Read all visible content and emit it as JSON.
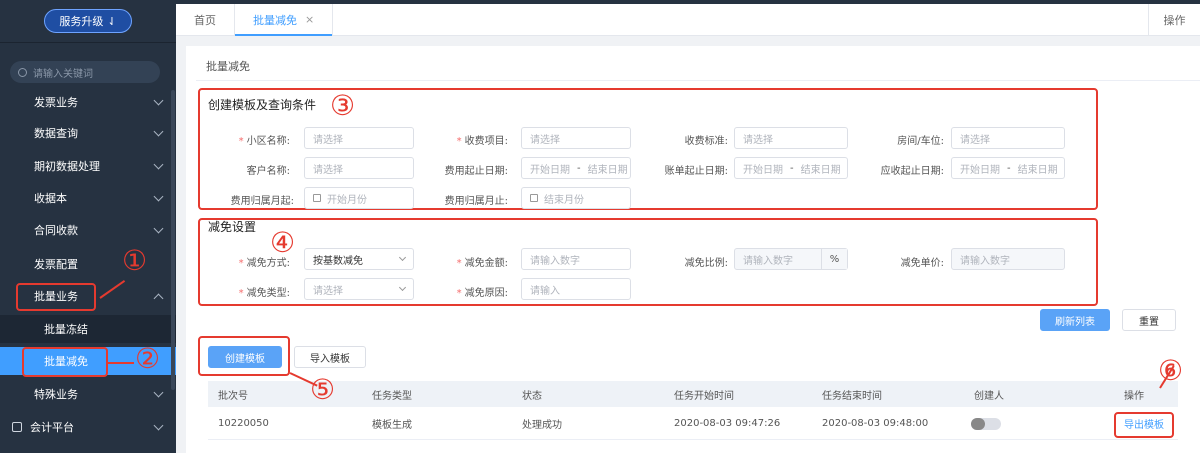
{
  "sidebar": {
    "upgrade_label": "服务升级",
    "search_placeholder": "请输入关键词",
    "items": [
      {
        "label": "发票业务"
      },
      {
        "label": "数据查询"
      },
      {
        "label": "期初数据处理"
      },
      {
        "label": "收据本"
      },
      {
        "label": "合同收款"
      },
      {
        "label": "发票配置"
      },
      {
        "label": "批量业务"
      },
      {
        "label": "批量冻结"
      },
      {
        "label": "批量减免"
      },
      {
        "label": "特殊业务"
      },
      {
        "label": "会计平台"
      }
    ]
  },
  "tabs": [
    {
      "label": "首页"
    },
    {
      "label": "批量减免",
      "close": "×"
    }
  ],
  "tab_actions_label": "操作",
  "page_title": "批量减免",
  "query_section": {
    "title": "创建模板及查询条件",
    "fields": {
      "community": {
        "label": "小区名称:",
        "placeholder": "请选择"
      },
      "charge_item": {
        "label": "收费项目:",
        "placeholder": "请选择"
      },
      "charge_standard": {
        "label": "收费标准:",
        "placeholder": "请选择"
      },
      "room": {
        "label": "房间/车位:",
        "placeholder": "请选择"
      },
      "customer": {
        "label": "客户名称:",
        "placeholder": "请选择"
      },
      "fee_date": {
        "label": "费用起止日期:",
        "start": "开始日期",
        "sep": "-",
        "end": "结束日期"
      },
      "bill_date": {
        "label": "账单起止日期:",
        "start": "开始日期",
        "sep": "-",
        "end": "结束日期"
      },
      "receivable_date": {
        "label": "应收起止日期:",
        "start": "开始日期",
        "sep": "-",
        "end": "结束日期"
      },
      "month_start": {
        "label": "费用归属月起:",
        "placeholder": "开始月份"
      },
      "month_end": {
        "label": "费用归属月止:",
        "placeholder": "结束月份"
      }
    }
  },
  "reduction_section": {
    "title": "减免设置",
    "fields": {
      "method": {
        "label": "减免方式:",
        "value": "按基数减免"
      },
      "amount": {
        "label": "减免金额:",
        "placeholder": "请输入数字"
      },
      "ratio": {
        "label": "减免比例:",
        "placeholder": "请输入数字",
        "unit": "%"
      },
      "unit_price": {
        "label": "减免单价:",
        "placeholder": "请输入数字"
      },
      "type": {
        "label": "减免类型:",
        "placeholder": "请选择"
      },
      "reason": {
        "label": "减免原因:",
        "placeholder": "请输入"
      }
    }
  },
  "buttons": {
    "refresh": "刷新列表",
    "reset": "重置",
    "create_template": "创建模板",
    "import_template": "导入模板"
  },
  "table": {
    "headers": [
      "批次号",
      "任务类型",
      "状态",
      "任务开始时间",
      "任务结束时间",
      "创建人",
      "操作"
    ],
    "rows": [
      {
        "batch": "10220050",
        "type": "模板生成",
        "status": "处理成功",
        "start": "2020-08-03 09:47:26",
        "end": "2020-08-03 09:48:00",
        "action": "导出模板"
      }
    ]
  },
  "annotations": [
    "①",
    "②",
    "③",
    "④",
    "⑤",
    "⑥"
  ],
  "colors": {
    "accent": "#409eff",
    "annotation": "#e53a2f",
    "sidebar_bg": "#263241",
    "required": "#f56c6c"
  }
}
